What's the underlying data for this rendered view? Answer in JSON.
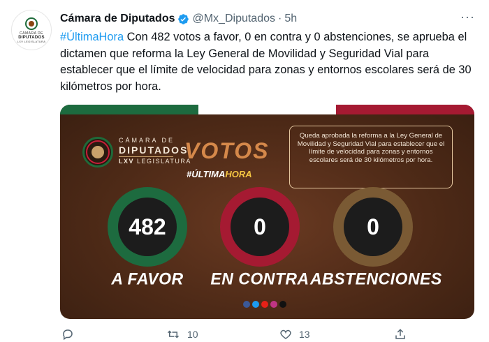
{
  "tweet": {
    "display_name": "Cámara de Diputados",
    "handle": "@Mx_Diputados",
    "separator": "·",
    "time": "5h",
    "more": "···",
    "hashtag": "#ÚltimaHora",
    "body": " Con 482 votos a favor, 0 en contra y 0 abstenciones, se aprueba el dictamen que reforma la Ley General de Movilidad y Seguridad Vial para establecer que el límite de velocidad para zonas y entornos escolares será de 30 kilómetros por hora."
  },
  "avatar": {
    "line1": "CÁMARA DE",
    "line2": "DIPUTADOS",
    "line3": "LXV LEGISLATURA"
  },
  "media": {
    "logo_line1": "CÁMARA DE",
    "logo_line2": "DIPUTADOS",
    "logo_line3_bold": "LXV",
    "logo_line3_rest": " LEGISLATURA",
    "headline": "VOTOS",
    "tag_prefix": "#ÚLTIMA",
    "tag_highlight": "HORA",
    "info": "Queda aprobada la reforma a la Ley General de Movilidad y Seguridad Vial para establecer que el límite de velocidad para zonas y entornos escolares será de 30 kilómetros por hora.",
    "favor_count": "482",
    "favor_label": "A FAVOR",
    "contra_count": "0",
    "contra_label": "EN CONTRA",
    "abst_count": "0",
    "abst_label": "ABSTENCIONES"
  },
  "actions": {
    "replies": "",
    "retweets": "10",
    "likes": "13"
  },
  "colors": {
    "link": "#1d9bf0",
    "verified": "#1d9bf0",
    "flag_green": "#1d6b3f",
    "flag_white": "#ffffff",
    "flag_red": "#a51a32",
    "votos_text": "#d5884a"
  },
  "icons": [
    "verified-badge-icon",
    "more-icon",
    "reply-icon",
    "retweet-icon",
    "like-icon",
    "share-icon",
    "facebook-icon",
    "twitter-icon",
    "youtube-icon",
    "instagram-icon",
    "tiktok-icon"
  ]
}
